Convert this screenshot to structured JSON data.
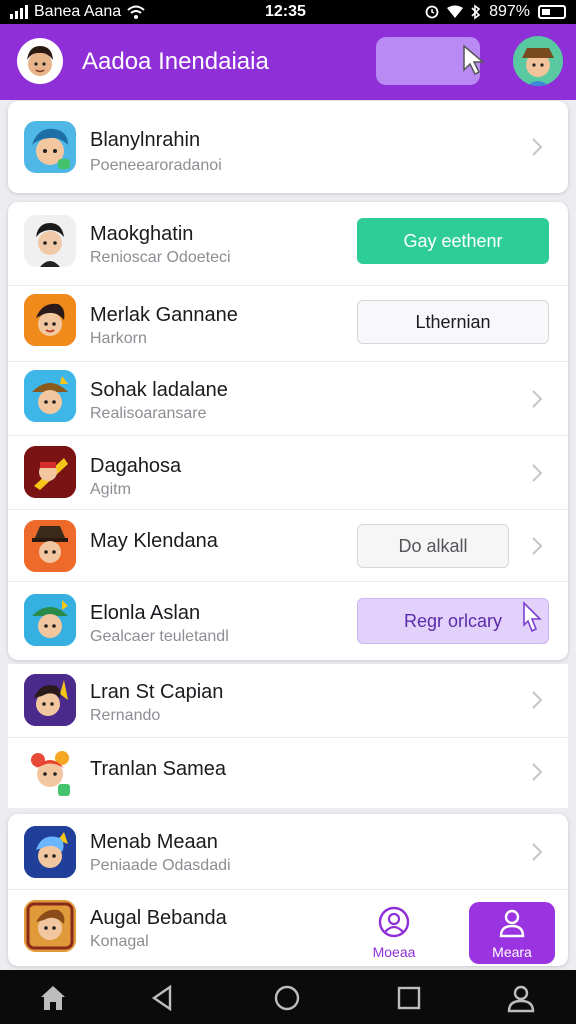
{
  "status_bar": {
    "carrier": "Banea Aana",
    "time": "12:35",
    "battery": "897%"
  },
  "header": {
    "title": "Aadoa Inendaiaia",
    "header_action_label": ""
  },
  "top_card": {
    "name": "Blanylnrahin",
    "sub": "Poeneearoradanoi"
  },
  "list": [
    {
      "name": "Maokghatin",
      "sub": "Renioscar Odoeteci",
      "action": "Gay eethenr",
      "action_style": "green"
    },
    {
      "name": "Merlak Gannane",
      "sub": "Harkorn",
      "action": "Lthernian",
      "action_style": "outline"
    },
    {
      "name": "Sohak ladalane",
      "sub": "Realisoaransare",
      "action": "",
      "action_style": "chevron"
    },
    {
      "name": "Dagahosa",
      "sub": "Agitm",
      "action": "",
      "action_style": "chevron"
    },
    {
      "name": "May Klendana",
      "sub": "",
      "action": "Do alkall",
      "action_style": "gray"
    },
    {
      "name": "Elonla Aslan",
      "sub": "Gealcaer teuletandl",
      "action": "Regr orlcary",
      "action_style": "purple"
    }
  ],
  "list2": [
    {
      "name": "Lran St Capian",
      "sub": "Rernando"
    },
    {
      "name": "Tranlan Samea",
      "sub": ""
    }
  ],
  "list3": [
    {
      "name": "Menab Meaan",
      "sub": "Peniaade Odasdadi"
    },
    {
      "name": "Augal Bebanda",
      "sub": "Konagal"
    }
  ],
  "tabs": [
    {
      "label": "Moeaa",
      "icon": "profile-circle-icon",
      "active": false
    },
    {
      "label": "Meara",
      "icon": "person-icon",
      "active": true
    }
  ],
  "colors": {
    "brand_purple": "#8e2fd8",
    "green": "#2ecc96",
    "light_purple": "#e2d2fb"
  }
}
